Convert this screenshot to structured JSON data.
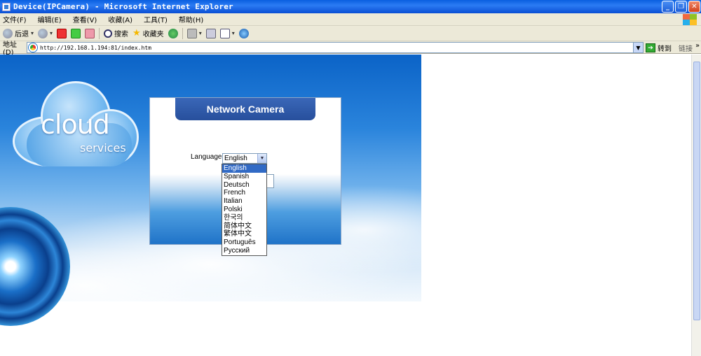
{
  "window": {
    "title": "Device(IPCamera) - Microsoft Internet Explorer",
    "buttons": [
      "_",
      "❐",
      "✕"
    ]
  },
  "menu": {
    "items": [
      "文件(F)",
      "编辑(E)",
      "查看(V)",
      "收藏(A)",
      "工具(T)",
      "帮助(H)"
    ]
  },
  "toolbar": {
    "back_label": "后退",
    "search_label": "搜索",
    "favorites_label": "收藏夹"
  },
  "address": {
    "label": "地址(D)",
    "url": "http://192.168.1.194:81/index.htm",
    "go_label": "转到",
    "links_label": "链接",
    "more": "»"
  },
  "page": {
    "logo_text": "cloud",
    "logo_subtext": "services",
    "panel_title": "Network Camera",
    "language_label": "Language",
    "selected_language": "English",
    "languages": [
      "English",
      "Spanish",
      "Deutsch",
      "French",
      "Italian",
      "Polski",
      "한국의",
      "简体中文",
      "繁体中文",
      "Português",
      "Русский"
    ]
  },
  "colors": {
    "titlebar": "#0a5fe0",
    "chrome": "#ece9d8",
    "panel_header": "#274f9c",
    "selection": "#316ac5"
  }
}
